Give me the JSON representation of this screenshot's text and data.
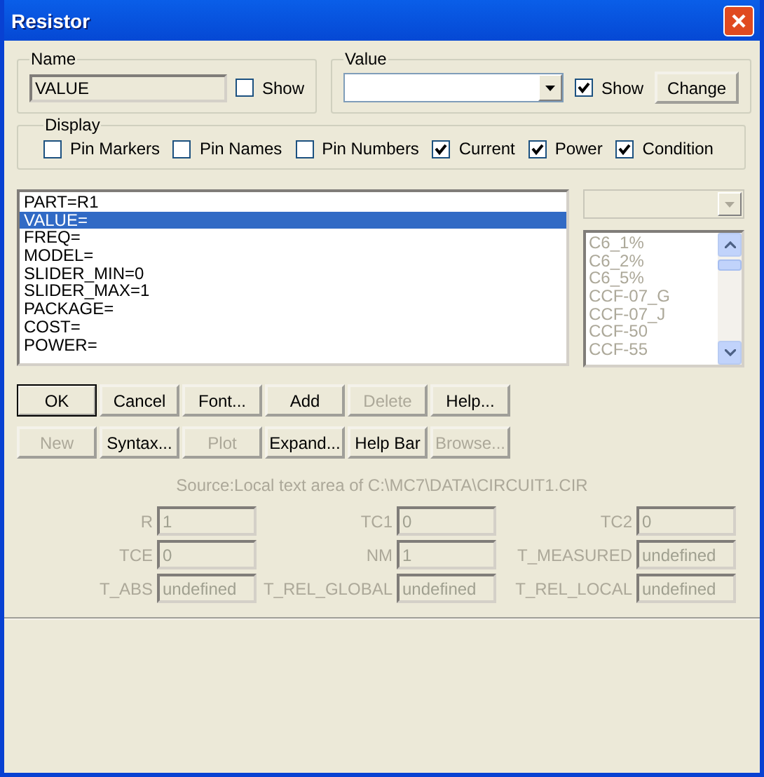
{
  "window": {
    "title": "Resistor"
  },
  "name_group": {
    "legend": "Name",
    "value": "VALUE",
    "show": {
      "label": "Show",
      "checked": false
    }
  },
  "value_group": {
    "legend": "Value",
    "show": {
      "label": "Show",
      "checked": true
    },
    "button": "Change"
  },
  "display": {
    "legend": "Display",
    "options": [
      {
        "label": "Pin Markers",
        "checked": false
      },
      {
        "label": "Pin Names",
        "checked": false
      },
      {
        "label": "Pin Numbers",
        "checked": false
      },
      {
        "label": "Current",
        "checked": true
      },
      {
        "label": "Power",
        "checked": true
      },
      {
        "label": "Condition",
        "checked": true
      }
    ]
  },
  "attributes": [
    {
      "text": "PART=R1",
      "selected": false
    },
    {
      "text": "VALUE=",
      "selected": true
    },
    {
      "text": "FREQ=",
      "selected": false
    },
    {
      "text": "MODEL=",
      "selected": false
    },
    {
      "text": "SLIDER_MIN=0",
      "selected": false
    },
    {
      "text": "SLIDER_MAX=1",
      "selected": false
    },
    {
      "text": "PACKAGE=",
      "selected": false
    },
    {
      "text": "COST=",
      "selected": false
    },
    {
      "text": "POWER=",
      "selected": false
    }
  ],
  "model_list": {
    "disabled": true,
    "items": [
      "C6_1%",
      "C6_2%",
      "C6_5%",
      "CCF-07_G",
      "CCF-07_J",
      "CCF-50",
      "CCF-55"
    ]
  },
  "button_rows": [
    [
      {
        "label": "OK",
        "disabled": false,
        "default": true
      },
      {
        "label": "Cancel",
        "disabled": false,
        "default": false
      },
      {
        "label": "Font...",
        "disabled": false,
        "default": false
      },
      {
        "label": "Add",
        "disabled": false,
        "default": false
      },
      {
        "label": "Delete",
        "disabled": true,
        "default": false
      },
      {
        "label": "Help...",
        "disabled": false,
        "default": false
      }
    ],
    [
      {
        "label": "New",
        "disabled": true,
        "default": false
      },
      {
        "label": "Syntax...",
        "disabled": false,
        "default": false
      },
      {
        "label": "Plot",
        "disabled": true,
        "default": false
      },
      {
        "label": "Expand...",
        "disabled": false,
        "default": false
      },
      {
        "label": "Help Bar",
        "disabled": false,
        "default": false
      },
      {
        "label": "Browse...",
        "disabled": true,
        "default": false
      }
    ]
  ],
  "source": "Source:Local text area of C:\\MC7\\DATA\\CIRCUIT1.CIR",
  "parameters": {
    "disabled": true,
    "items": [
      {
        "label": "R",
        "value": "1"
      },
      {
        "label": "TC1",
        "value": "0"
      },
      {
        "label": "TC2",
        "value": "0"
      },
      {
        "label": "TCE",
        "value": "0"
      },
      {
        "label": "NM",
        "value": "1"
      },
      {
        "label": "T_MEASURED",
        "value": "undefined"
      },
      {
        "label": "T_ABS",
        "value": "undefined"
      },
      {
        "label": "T_REL_GLOBAL",
        "value": "undefined"
      },
      {
        "label": "T_REL_LOCAL",
        "value": "undefined"
      }
    ]
  }
}
